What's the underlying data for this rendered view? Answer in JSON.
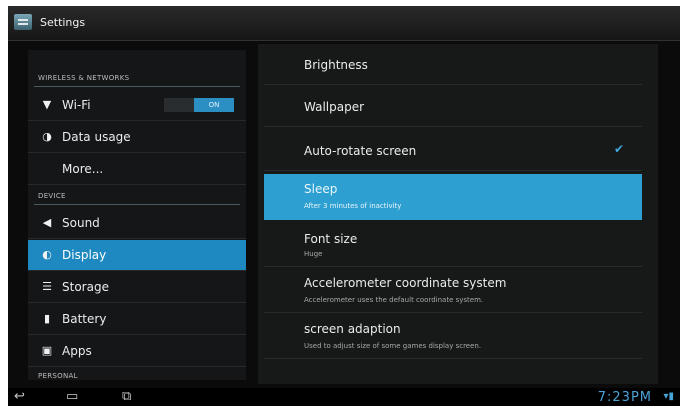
{
  "app": {
    "title": "Settings",
    "icon": "settings-icon"
  },
  "categories": {
    "wireless": "WIRELESS & NETWORKS",
    "device": "DEVICE",
    "personal": "PERSONAL"
  },
  "headers": [
    {
      "id": "wifi",
      "label": "Wi-Fi",
      "icon": "wifi-icon",
      "toggle": "ON"
    },
    {
      "id": "data-usage",
      "label": "Data usage",
      "icon": "data-usage-icon"
    },
    {
      "id": "more",
      "label": "More..."
    },
    {
      "id": "sound",
      "label": "Sound",
      "icon": "speaker-icon"
    },
    {
      "id": "display",
      "label": "Display",
      "icon": "display-icon",
      "selected": true
    },
    {
      "id": "storage",
      "label": "Storage",
      "icon": "storage-icon"
    },
    {
      "id": "battery",
      "label": "Battery",
      "icon": "battery-icon"
    },
    {
      "id": "apps",
      "label": "Apps",
      "icon": "apps-icon"
    }
  ],
  "display_prefs": [
    {
      "title": "Brightness"
    },
    {
      "title": "Wallpaper"
    },
    {
      "title": "Auto-rotate screen",
      "checked": true
    },
    {
      "title": "Sleep",
      "summary": "After 3 minutes of inactivity",
      "selected": true
    },
    {
      "title": "Font size",
      "summary": "Huge"
    },
    {
      "title": "Accelerometer coordinate system",
      "summary": "Accelerometer uses the default coordinate system."
    },
    {
      "title": "screen adaption",
      "summary": "Used to adjust size of some games display screen."
    }
  ],
  "navbar": {
    "back": "back-icon",
    "home": "home-icon",
    "recents": "recents-icon",
    "clock": "7:23PM"
  },
  "colors": {
    "accent": "#2d9fd0",
    "selected_header": "#1e88c0"
  }
}
